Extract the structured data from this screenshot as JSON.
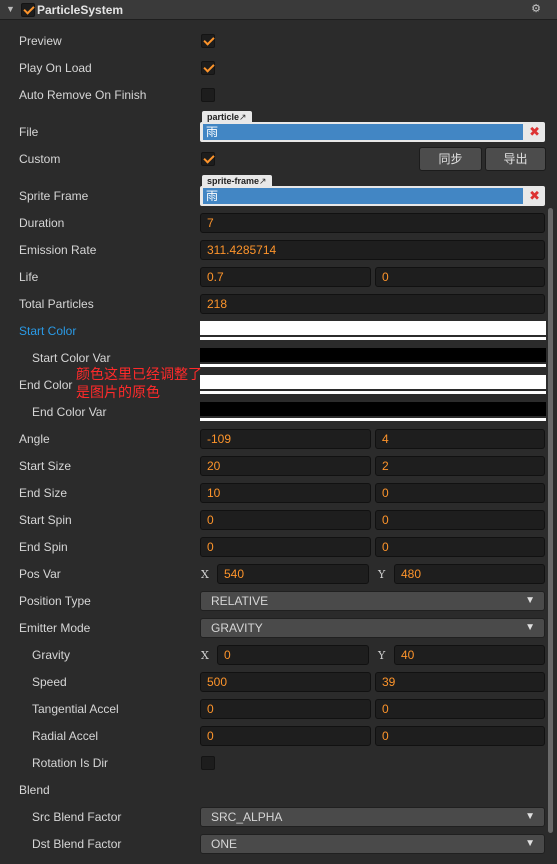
{
  "header": {
    "title": "ParticleSystem",
    "enabled": true,
    "gear_icon": "gear-icon",
    "collapse_icon": "triangle-down-icon"
  },
  "fields": {
    "preview": {
      "label": "Preview",
      "checked": true
    },
    "play_on_load": {
      "label": "Play On Load",
      "checked": true
    },
    "auto_remove": {
      "label": "Auto Remove On Finish",
      "checked": false
    },
    "file": {
      "label": "File",
      "type_tag": "particle",
      "value": "雨"
    },
    "custom": {
      "label": "Custom",
      "checked": true,
      "sync_button": "同步",
      "export_button": "导出"
    },
    "sprite_frame": {
      "label": "Sprite Frame",
      "type_tag": "sprite-frame",
      "value": "雨"
    },
    "duration": {
      "label": "Duration",
      "value": "7"
    },
    "emission_rate": {
      "label": "Emission Rate",
      "value": "311.4285714"
    },
    "life": {
      "label": "Life",
      "value": "0.7",
      "var": "0"
    },
    "total_particles": {
      "label": "Total Particles",
      "value": "218"
    },
    "start_color": {
      "label": "Start Color",
      "color": "#ffffff"
    },
    "start_color_var": {
      "label": "Start Color Var",
      "color": "#000000"
    },
    "end_color": {
      "label": "End Color",
      "color": "#ffffff"
    },
    "end_color_var": {
      "label": "End Color Var",
      "color": "#000000"
    },
    "angle": {
      "label": "Angle",
      "value": "-109",
      "var": "4"
    },
    "start_size": {
      "label": "Start Size",
      "value": "20",
      "var": "2"
    },
    "end_size": {
      "label": "End Size",
      "value": "10",
      "var": "0"
    },
    "start_spin": {
      "label": "Start Spin",
      "value": "0",
      "var": "0"
    },
    "end_spin": {
      "label": "End Spin",
      "value": "0",
      "var": "0"
    },
    "pos_var": {
      "label": "Pos Var",
      "x_label": "X",
      "x": "540",
      "y_label": "Y",
      "y": "480"
    },
    "position_type": {
      "label": "Position Type",
      "value": "RELATIVE"
    },
    "emitter_mode": {
      "label": "Emitter Mode",
      "value": "GRAVITY"
    },
    "gravity": {
      "label": "Gravity",
      "x_label": "X",
      "x": "0",
      "y_label": "Y",
      "y": "40"
    },
    "speed": {
      "label": "Speed",
      "value": "500",
      "var": "39"
    },
    "tangential_accel": {
      "label": "Tangential Accel",
      "value": "0",
      "var": "0"
    },
    "radial_accel": {
      "label": "Radial Accel",
      "value": "0",
      "var": "0"
    },
    "rotation_is_dir": {
      "label": "Rotation Is Dir",
      "checked": false
    },
    "blend": {
      "label": "Blend"
    },
    "src_blend_factor": {
      "label": "Src Blend Factor",
      "value": "SRC_ALPHA"
    },
    "dst_blend_factor": {
      "label": "Dst Blend Factor",
      "value": "ONE"
    }
  },
  "annotation": {
    "line1": "颜色这里已经调整了",
    "line2": "是图片的原色"
  },
  "colors": {
    "accent": "#fd942b",
    "link_label": "#2a9ae6",
    "asset_value_bg": "#4286c4",
    "annotation": "#ff2a2a"
  }
}
